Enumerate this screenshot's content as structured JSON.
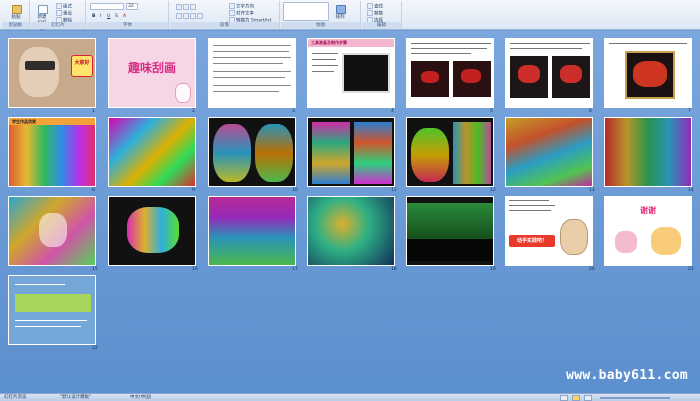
{
  "ribbon": {
    "groups": [
      {
        "label": "剪贴板",
        "buttons": [
          "粘贴"
        ]
      },
      {
        "label": "幻灯片",
        "buttons": [
          "新建幻灯片",
          "版式",
          "重设",
          "删除"
        ]
      },
      {
        "label": "字体",
        "buttons": [
          "B",
          "I",
          "U",
          "S",
          "A"
        ]
      },
      {
        "label": "段落",
        "buttons": [
          "文字方向",
          "对齐文本",
          "转换为 SmartArt"
        ]
      },
      {
        "label": "绘图",
        "buttons": [
          "排列",
          "快速样式"
        ]
      },
      {
        "label": "编辑",
        "buttons": [
          "查找",
          "替换",
          "选择"
        ]
      }
    ],
    "font_size": "32"
  },
  "slides": [
    {
      "number": "1",
      "title": "大家好",
      "bg": "#c7a98c"
    },
    {
      "number": "2",
      "title": "趣味刮画",
      "bg": "#f6d6e6"
    },
    {
      "number": "3",
      "title": "",
      "bg": "#ffffff"
    },
    {
      "number": "4",
      "title": "工具准备及制作步骤",
      "bg": "#ffffff"
    },
    {
      "number": "5",
      "title": "",
      "bg": "#ffffff"
    },
    {
      "number": "6",
      "title": "",
      "bg": "#ffffff"
    },
    {
      "number": "7",
      "title": "",
      "bg": "#ffffff"
    },
    {
      "number": "8",
      "title": "学生作品欣赏",
      "bg": "#111111"
    },
    {
      "number": "9",
      "title": "",
      "bg": "#111111"
    },
    {
      "number": "10",
      "title": "",
      "bg": "#111111"
    },
    {
      "number": "11",
      "title": "",
      "bg": "#111111"
    },
    {
      "number": "12",
      "title": "",
      "bg": "#111111"
    },
    {
      "number": "13",
      "title": "",
      "bg": "#111111"
    },
    {
      "number": "14",
      "title": "",
      "bg": "#111111"
    },
    {
      "number": "15",
      "title": "",
      "bg": "#111111"
    },
    {
      "number": "16",
      "title": "",
      "bg": "#111111"
    },
    {
      "number": "17",
      "title": "",
      "bg": "#111111"
    },
    {
      "number": "18",
      "title": "",
      "bg": "#111111"
    },
    {
      "number": "19",
      "title": "",
      "bg": "#111111"
    },
    {
      "number": "20",
      "title": "动手实践吧！",
      "bg": "#ffffff"
    },
    {
      "number": "21",
      "title": "谢谢",
      "bg": "#ffffff"
    },
    {
      "number": "22",
      "title": "",
      "bg": "#74a6d8"
    }
  ],
  "status": {
    "slide_info": "幻灯片浏览",
    "theme": "\"默认设计模板\"",
    "language": "中文(中国)"
  },
  "watermark": "www.baby611.com",
  "colors": {
    "accent": "#ffd45a",
    "sorter_bg": "#6f9cd4"
  }
}
